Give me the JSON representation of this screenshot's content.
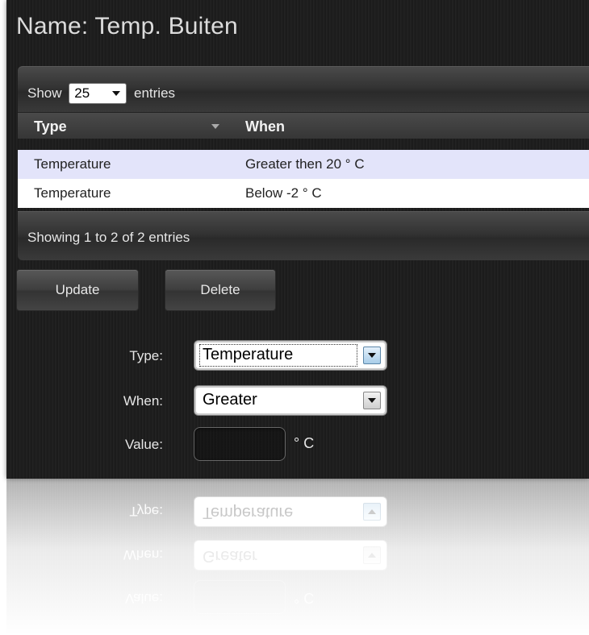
{
  "page": {
    "title": "Name: Temp. Buiten"
  },
  "table": {
    "show_label": "Show",
    "length_value": "25",
    "entries_label": "entries",
    "columns": [
      "Type",
      "When"
    ],
    "rows": [
      [
        "Temperature",
        "Greater then 20 ° C"
      ],
      [
        "Temperature",
        "Below -2 ° C"
      ]
    ],
    "info": "Showing 1 to 2 of 2 entries"
  },
  "actions": {
    "update_label": "Update",
    "delete_label": "Delete"
  },
  "form": {
    "type_label": "Type:",
    "type_value": "Temperature",
    "when_label": "When:",
    "when_value": "Greater",
    "value_label": "Value:",
    "value_value": "",
    "unit": "° C"
  },
  "colors": {
    "background": "#1e1e1e",
    "selected_row": "#e3e4fa",
    "text_light": "#e6e6e6"
  }
}
